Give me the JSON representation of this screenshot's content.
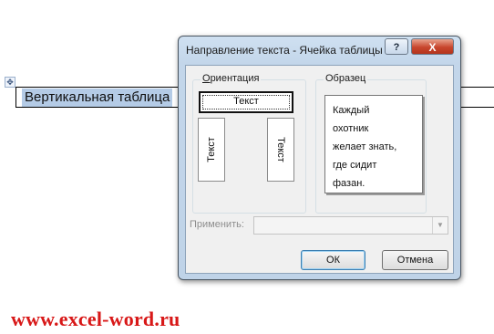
{
  "document": {
    "move_handle_icon": "✥",
    "cell_text": "Вертикальная таблица",
    "watermark": "www.excel-word.ru"
  },
  "dialog": {
    "title": "Направление текста - Ячейка таблицы",
    "help_label": "?",
    "close_label": "X",
    "orientation": {
      "label_prefix": "",
      "label_underlined": "О",
      "label_rest": "риентация",
      "options": [
        {
          "label": "Текст",
          "direction": "horizontal",
          "selected": true
        },
        {
          "label": "Текст",
          "direction": "vertical-up",
          "selected": false
        },
        {
          "label": "Текст",
          "direction": "vertical-down",
          "selected": false
        }
      ]
    },
    "sample": {
      "label": "Образец",
      "lines": [
        "Каждый",
        "охотник",
        "желает знать,",
        "где сидит",
        "фазан."
      ]
    },
    "apply": {
      "label": "Применить:",
      "value": "",
      "enabled": false
    },
    "buttons": {
      "ok": "ОК",
      "cancel": "Отмена"
    }
  }
}
